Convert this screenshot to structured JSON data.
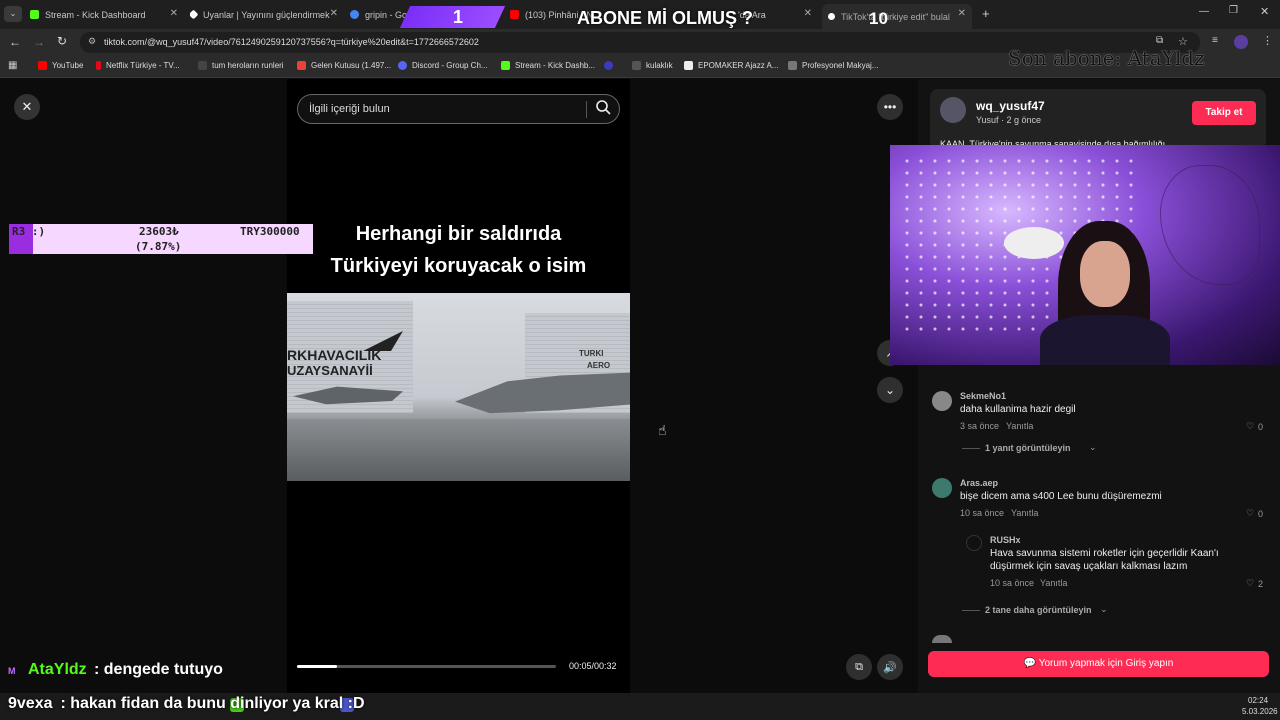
{
  "tabs": [
    {
      "label": "Stream - Kick Dashboard",
      "icon": "kick-icon",
      "color": "#53fc18"
    },
    {
      "label": "Uyanlar | Yayınını güçlendirmek",
      "icon": "diamond-icon",
      "color": "#ffffff"
    },
    {
      "label": "gripin - Google'da",
      "icon": "google-icon",
      "color": "#4285f4"
    },
    {
      "label": "(103) Pinhâni - N",
      "icon": "youtube-icon",
      "color": "#ff0000"
    },
    {
      "label": "'da Ara",
      "icon": "google-icon",
      "color": "#4285f4"
    },
    {
      "label": "TikTok'ta \"türkiye edit\" bulal",
      "icon": "tiktok-icon",
      "color": "#ffffff"
    }
  ],
  "overlay": {
    "abone_question": "ABONE Mİ OLMUŞ ?",
    "count_left": "1",
    "count_right": "10",
    "last_sub": "Son abone: AtaYldz",
    "goal_label": "R3 :)",
    "goal_current": "23603₺",
    "goal_target": "TRY300000",
    "goal_percent": "(7.87%)",
    "goal_fraction": 0.0787,
    "chat_name": "AtaYldz",
    "chat_msg": ": dengede tutuyo",
    "chat2_name": "9vexa",
    "chat2_msg": " : hakan fidan da bunu dinliyor ya kral :D"
  },
  "address": {
    "url": "tiktok.com/@wq_yusuf47/video/7612490259120737556?q=türkiye%20edit&t=1772666572602"
  },
  "bookmarks": [
    {
      "label": "YouTube",
      "color": "#ff0000"
    },
    {
      "label": "Netflix Türkiye - TV...",
      "color": "#e50914"
    },
    {
      "label": "tum heroların runleri",
      "color": "#cccccc"
    },
    {
      "label": "Gelen Kutusu (1.497...",
      "color": "#ea4335"
    },
    {
      "label": "Discord - Group Ch...",
      "color": "#5865f2"
    },
    {
      "label": "Stream - Kick Dashb...",
      "color": "#53fc18"
    },
    {
      "label": "",
      "color": "#3b3bbf"
    },
    {
      "label": "kulaklık",
      "color": "#dddddd"
    },
    {
      "label": "EPOMAKER Ajazz A...",
      "color": "#eeeeee"
    },
    {
      "label": "Profesyonel Makyaj...",
      "color": "#999999"
    }
  ],
  "video": {
    "search_placeholder": "İlgili içeriği bulun",
    "caption_line1": "Herhangi bir saldırıda",
    "caption_line2": "Türkiyeyi koruyacak o isim",
    "hangar_text1": "RKHAVACILIK",
    "hangar_text2": "UZAYSANAYİİ",
    "hangar_text3": "TURKI",
    "hangar_text4": "AERO",
    "time": "00:05/00:32",
    "progress": 0.156
  },
  "author": {
    "username": "wq_yusuf47",
    "meta": "Yusuf · 2 g önce",
    "follow_label": "Takip et",
    "description": "KAAN. Türkiye'nin savunma sanayisinde dışa bağımlılığı"
  },
  "comments": [
    {
      "user": "SekmeNo1",
      "text": "daha kullanima hazir degil",
      "time": "3 sa önce",
      "reply": "Yanıtla",
      "likes": "0",
      "view_replies": "1 yanıt görüntüleyin"
    },
    {
      "user": "Aras.aep",
      "text": "bişe dicem ama s400 Lee bunu düşüremezmi",
      "time": "10 sa önce",
      "reply": "Yanıtla",
      "likes": "0"
    },
    {
      "user": "RUSHx",
      "text_line1": "Hava savunma sistemi roketler için geçerlidir Kaan'ı",
      "text_line2": "düşürmek için savaş uçakları kalkması lazım",
      "time": "10 sa önce",
      "reply": "Yanıtla",
      "likes": "2",
      "view_more": "2 tane daha görüntüleyin"
    }
  ],
  "login_comment": "Yorum yapmak için Giriş yapın",
  "clock": {
    "time": "02:24",
    "date": "5.03.2026"
  }
}
